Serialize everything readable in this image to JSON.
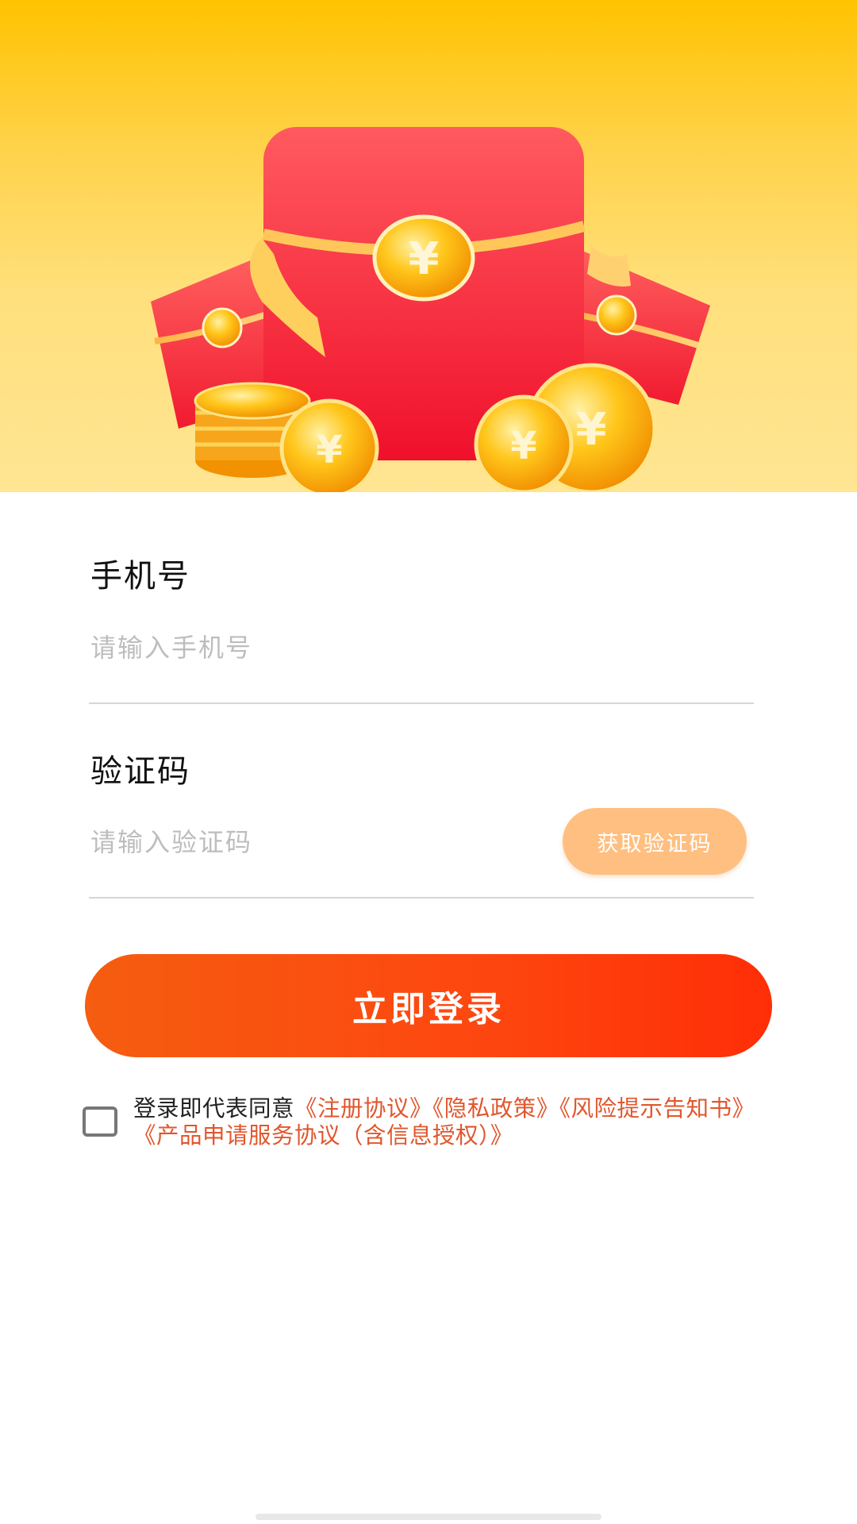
{
  "hero": {
    "currency_symbol": "¥"
  },
  "form": {
    "phone": {
      "label": "手机号",
      "placeholder": "请输入手机号"
    },
    "code": {
      "label": "验证码",
      "placeholder": "请输入验证码",
      "button_label": "获取验证码"
    },
    "login_label": "立即登录"
  },
  "agreement": {
    "prefix": "登录即代表同意",
    "links": [
      "《注册协议》",
      "《隐私政策》",
      "《风险提示告知书》",
      "《产品申请服务协议（含信息授权）》"
    ],
    "checked": false
  },
  "colors": {
    "accent": "#fd4810",
    "link": "#e1562d",
    "code_button": "#ffbf80",
    "hero_top": "#ffc300"
  }
}
